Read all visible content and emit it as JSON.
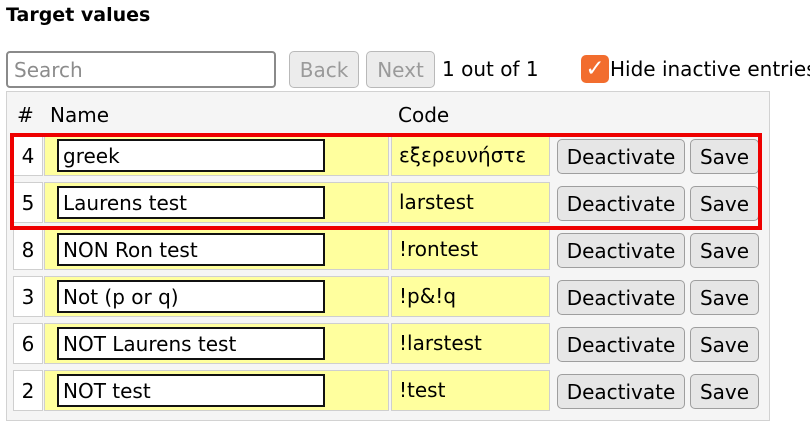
{
  "title": "Target values",
  "search": {
    "placeholder": "Search",
    "value": ""
  },
  "nav": {
    "back": "Back",
    "next": "Next",
    "pager": "1 out of 1"
  },
  "filter": {
    "label": "Hide inactive entries",
    "checked": true,
    "check_color": "#f26d2e"
  },
  "table": {
    "headers": {
      "num": "#",
      "name": "Name",
      "code": "Code"
    },
    "rows": [
      {
        "num": "4",
        "name": "greek",
        "code": "εξερευνήστε",
        "deactivate": "Deactivate",
        "save": "Save"
      },
      {
        "num": "5",
        "name": "Laurens test",
        "code": "larstest",
        "deactivate": "Deactivate",
        "save": "Save"
      },
      {
        "num": "8",
        "name": "NON Ron test",
        "code": "!rontest",
        "deactivate": "Deactivate",
        "save": "Save"
      },
      {
        "num": "3",
        "name": "Not (p or q)",
        "code": "!p&!q",
        "deactivate": "Deactivate",
        "save": "Save"
      },
      {
        "num": "6",
        "name": "NOT Laurens test",
        "code": "!larstest",
        "deactivate": "Deactivate",
        "save": "Save"
      },
      {
        "num": "2",
        "name": "NOT test",
        "code": "!test",
        "deactivate": "Deactivate",
        "save": "Save"
      }
    ]
  },
  "colors": {
    "cell_highlight": "#ffff9e",
    "annotation_box": "#ee0000"
  }
}
